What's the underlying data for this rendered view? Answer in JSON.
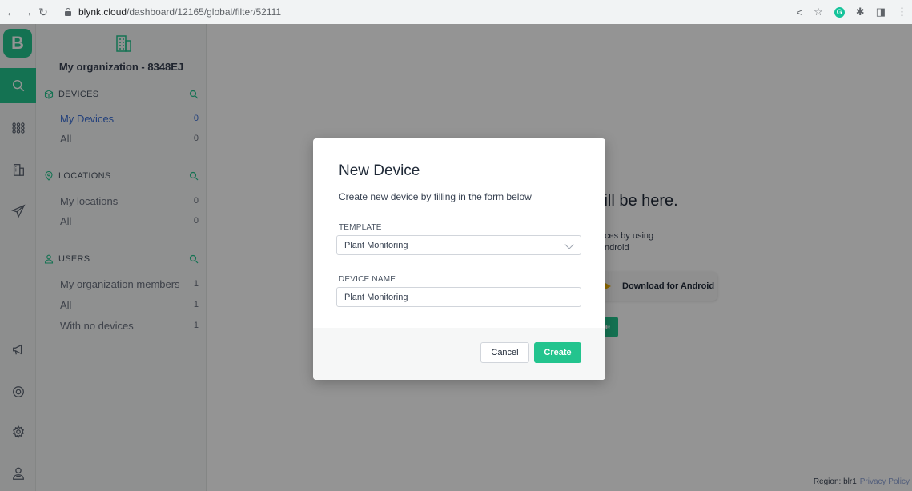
{
  "browser": {
    "url_host": "blynk.cloud",
    "url_path": "/dashboard/12165/global/filter/52111"
  },
  "rail": {
    "logo": "B",
    "items": [
      {
        "icon": "search-icon",
        "active": true
      },
      {
        "icon": "grid-icon",
        "active": false
      },
      {
        "icon": "building-icon",
        "active": false
      },
      {
        "icon": "send-icon",
        "active": false
      },
      {
        "icon": "megaphone-icon",
        "active": false
      },
      {
        "icon": "lifebuoy-icon",
        "active": false
      },
      {
        "icon": "settings-icon",
        "active": false
      },
      {
        "icon": "user-icon",
        "active": false
      }
    ]
  },
  "sidebar": {
    "org_name": "My organization - 8348EJ",
    "sections": {
      "devices": {
        "title": "DEVICES",
        "items": [
          {
            "label": "My Devices",
            "count": "0"
          },
          {
            "label": "All",
            "count": "0"
          }
        ]
      },
      "locations": {
        "title": "LOCATIONS",
        "items": [
          {
            "label": "My locations",
            "count": "0"
          },
          {
            "label": "All",
            "count": "0"
          }
        ]
      },
      "users": {
        "title": "USERS",
        "items": [
          {
            "label": "My organization members",
            "count": "1"
          },
          {
            "label": "All",
            "count": "1"
          },
          {
            "label": "With no devices",
            "count": "1"
          }
        ]
      }
    }
  },
  "main": {
    "empty_title": "will be here.",
    "empty_sub_line1": "ces by using",
    "empty_sub_line2": "ndroid",
    "android_button": "Download for Android",
    "green_chip": "e",
    "footer_region": "Region: blr1",
    "footer_policy": "Privacy Policy"
  },
  "modal": {
    "title": "New Device",
    "subtitle": "Create new device by filling in the form below",
    "template_label": "TEMPLATE",
    "template_value": "Plant Monitoring",
    "device_name_label": "DEVICE NAME",
    "device_name_value": "Plant Monitoring",
    "cancel": "Cancel",
    "create": "Create"
  },
  "colors": {
    "accent": "#23c48e",
    "link": "#3b6fd6"
  }
}
